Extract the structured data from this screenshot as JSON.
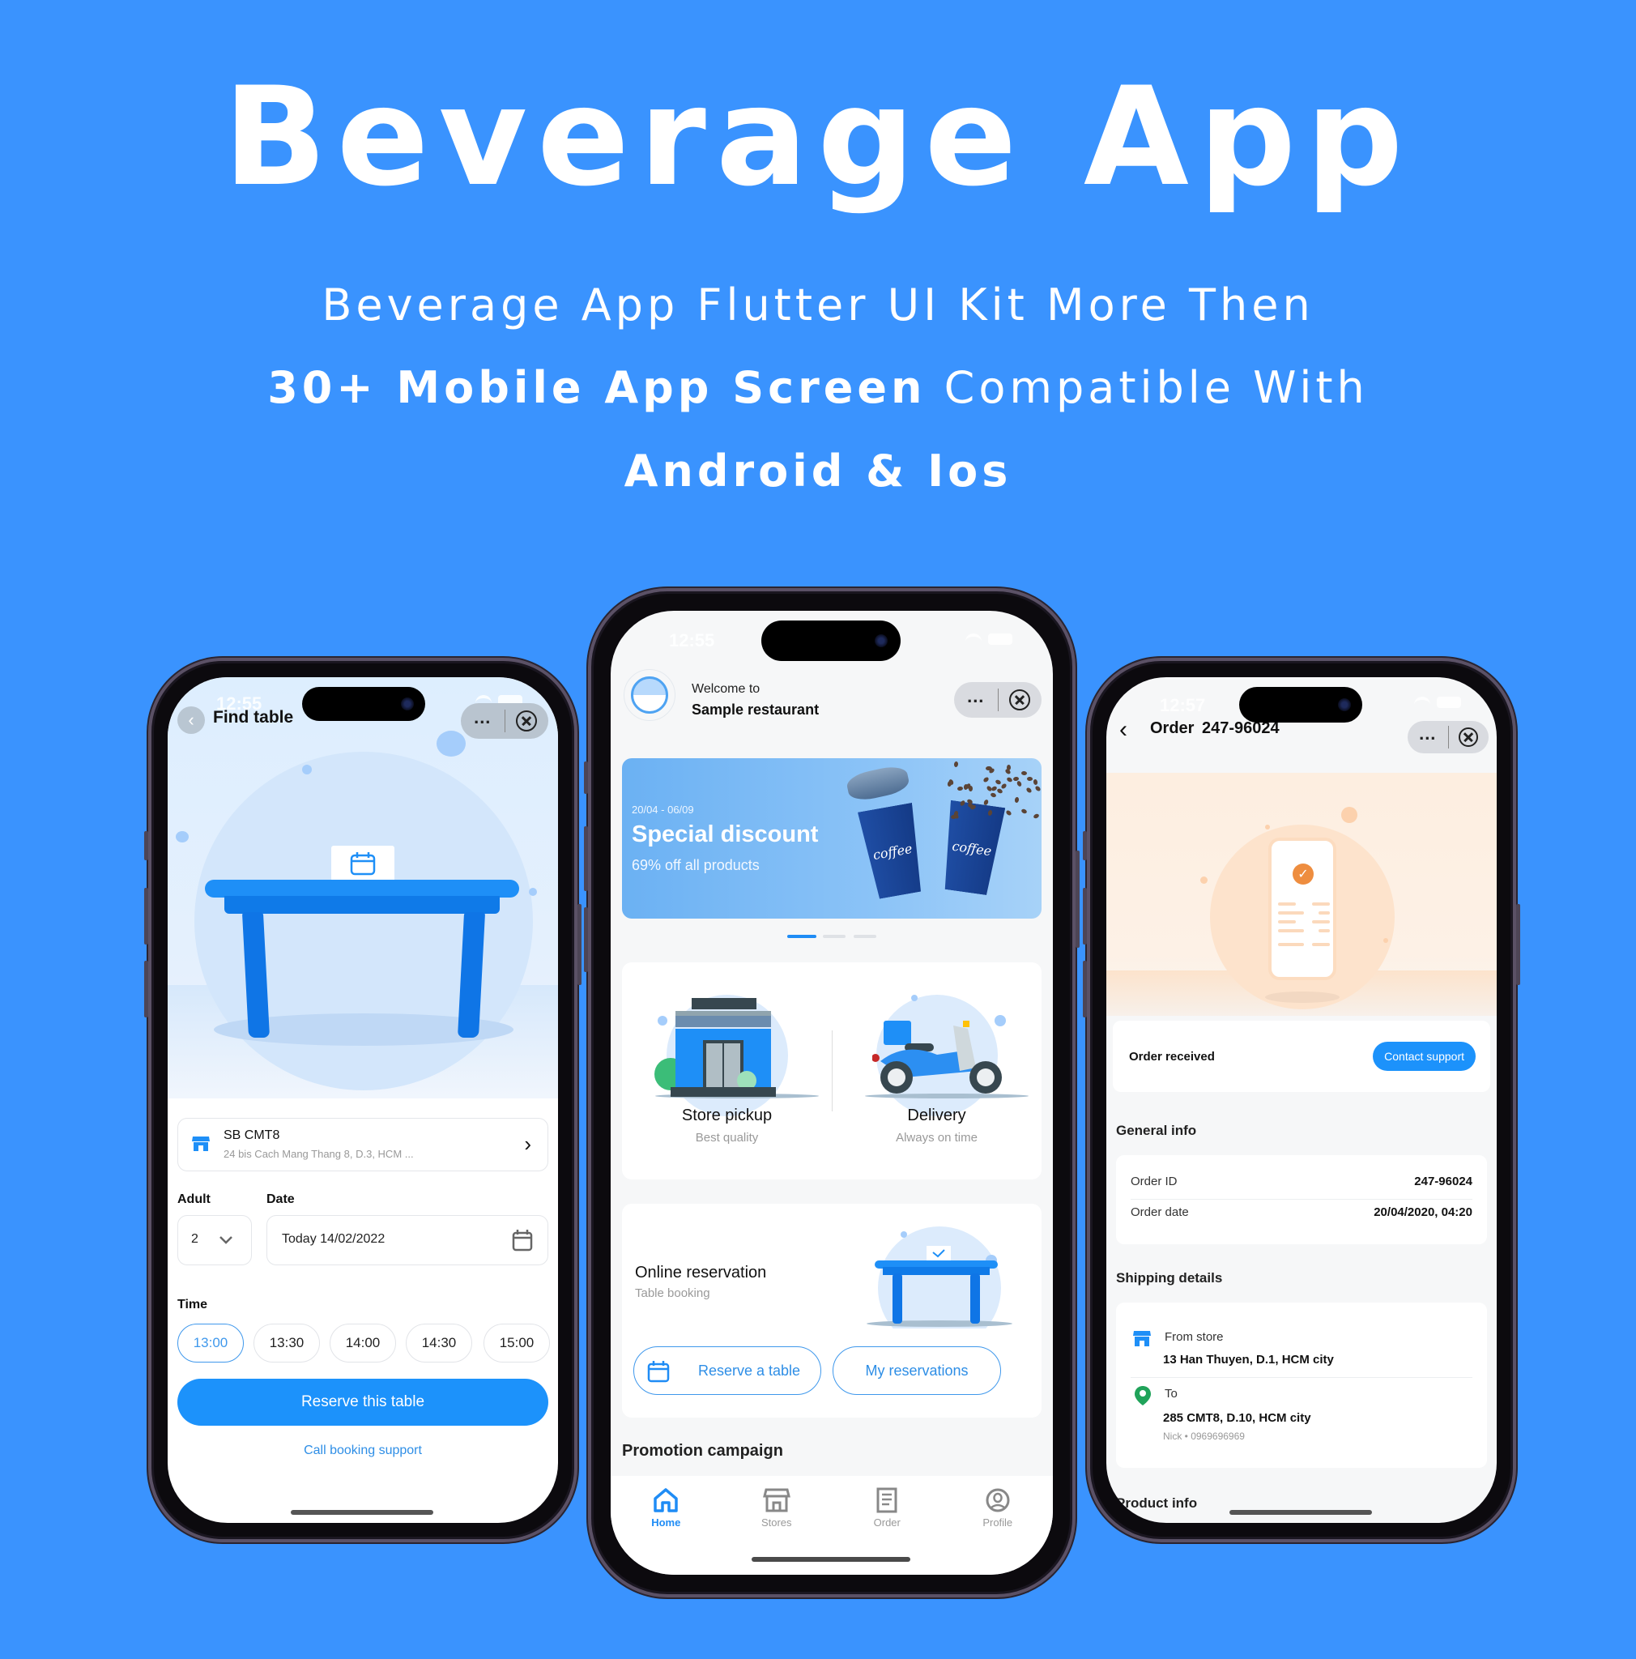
{
  "hero": {
    "title": "Beverage App",
    "line1": "Beverage App Flutter UI Kit More Then",
    "line2_bold": "30+ Mobile App Screen",
    "line2_rest": " Compatible With",
    "line3": "Android & Ios"
  },
  "colors": {
    "background": "#3a93fe",
    "primary": "#1c92fb",
    "accent_text": "#2e8ee6",
    "success_pin": "#20a35a",
    "order_check": "#ee8d3f"
  },
  "find_table_screen": {
    "status_time": "12:55",
    "title": "Find table",
    "capsule": {
      "more_label": "...",
      "close_icon": "close-circle-icon"
    },
    "store": {
      "name": "SB CMT8",
      "address": "24 bis Cach Mang Thang 8, D.3, HCM ..."
    },
    "adult_label": "Adult",
    "adult_value": "2",
    "date_label": "Date",
    "date_value": "Today 14/02/2022",
    "time_label": "Time",
    "time_slots": [
      "13:00",
      "13:30",
      "14:00",
      "14:30",
      "15:00"
    ],
    "selected_time": "13:00",
    "reserve_button": "Reserve this table",
    "support_link": "Call booking support"
  },
  "home_screen": {
    "status_time": "12:55",
    "welcome": "Welcome to",
    "restaurant": "Sample restaurant",
    "banner": {
      "date_range": "20/04 - 06/09",
      "title": "Special discount",
      "subtitle": "69% off all products",
      "cup_text": "coffee",
      "active_page": 1,
      "page_count": 3
    },
    "services": [
      {
        "name": "Store pickup",
        "desc": "Best quality"
      },
      {
        "name": "Delivery",
        "desc": "Always on time"
      }
    ],
    "reservation": {
      "title": "Online reservation",
      "subtitle": "Table booking",
      "reserve_button": "Reserve a table",
      "my_reservations_button": "My reservations"
    },
    "promotion_title": "Promotion campaign",
    "tabs": [
      {
        "label": "Home",
        "icon": "home-icon",
        "active": true
      },
      {
        "label": "Stores",
        "icon": "store-icon",
        "active": false
      },
      {
        "label": "Order",
        "icon": "receipt-icon",
        "active": false
      },
      {
        "label": "Profile",
        "icon": "profile-icon",
        "active": false
      }
    ]
  },
  "order_screen": {
    "status_time": "12:57",
    "title": "Order  247-96024",
    "status": "Order received",
    "contact_button": "Contact support",
    "general_info_title": "General info",
    "general_info": [
      {
        "key": "Order ID",
        "value": "247-96024"
      },
      {
        "key": "Order date",
        "value": "20/04/2020, 04:20"
      }
    ],
    "shipping_title": "Shipping details",
    "from_label": "From store",
    "from_address": "13 Han Thuyen, D.1, HCM city",
    "to_label": "To",
    "to_address": "285 CMT8, D.10, HCM city",
    "recipient": "Nick • 0969696969",
    "product_info_title": "Product info"
  }
}
